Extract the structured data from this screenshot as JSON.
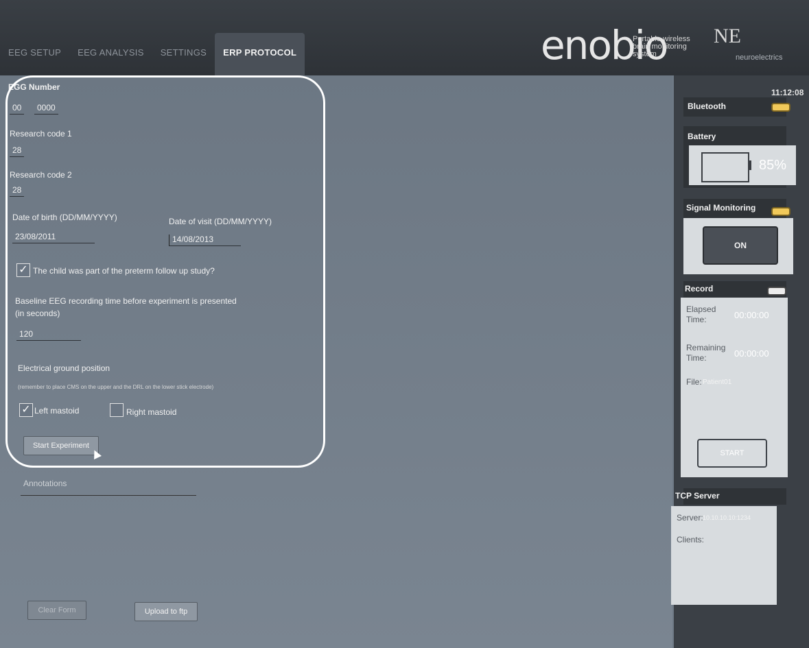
{
  "tabs": [
    {
      "label": "EEG SETUP"
    },
    {
      "label": "EEG ANALYSIS"
    },
    {
      "label": "SETTINGS"
    },
    {
      "label": "ERP PROTOCOL"
    }
  ],
  "brand": {
    "logo": "enobio",
    "tagline": [
      "Portable wireless",
      "brain monitoring",
      "system"
    ],
    "company_mark": "NE",
    "company": "neuroelectrics"
  },
  "clock": "11:12:08",
  "form": {
    "egg_number_label": "EGG Number",
    "egg_number_a": "00",
    "egg_number_b": "0000",
    "research1_label": "Research code 1",
    "research1_value": "28",
    "research2_label": "Research code 2",
    "research2_value": "28",
    "dob_label": "Date of birth (DD/MM/YYYY)",
    "dob_value": "23/08/2011",
    "dov_label": "Date of visit (DD/MM/YYYY)",
    "dov_value": "14/08/2013",
    "preterm_label": "The child was part of the preterm follow up study?",
    "preterm_checked": true,
    "baseline_label_1": "Baseline EEG recording time before experiment is presented",
    "baseline_label_2": "(in seconds)",
    "baseline_value": "120",
    "ground_label": "Electrical ground position",
    "ground_note": "(remember to place CMS on the upper and the DRL on the lower stick electrode)",
    "left_mastoid_label": "Left mastoid",
    "left_mastoid_checked": true,
    "right_mastoid_label": "Right mastoid",
    "right_mastoid_checked": false,
    "start_button": "Start Experiment"
  },
  "annotations": {
    "label": "Annotations",
    "clear_button": "Clear Form",
    "upload_button": "Upload to ftp"
  },
  "status": {
    "bluetooth_label": "Bluetooth",
    "battery_label": "Battery",
    "battery_percent": "85%",
    "signal_label": "Signal Monitoring",
    "signal_button": "ON",
    "record_label": "Record",
    "elapsed_label": "Elapsed Time:",
    "elapsed_value": "00:00:00",
    "remaining_label": "Remaining Time:",
    "remaining_value": "00:00:00",
    "file_label": "File:",
    "file_value": "Patient01",
    "start_button": "START",
    "tcp_label": "TCP Server",
    "server_label": "Server:",
    "server_value": "10.10.10.10:1234",
    "clients_label": "Clients:"
  }
}
